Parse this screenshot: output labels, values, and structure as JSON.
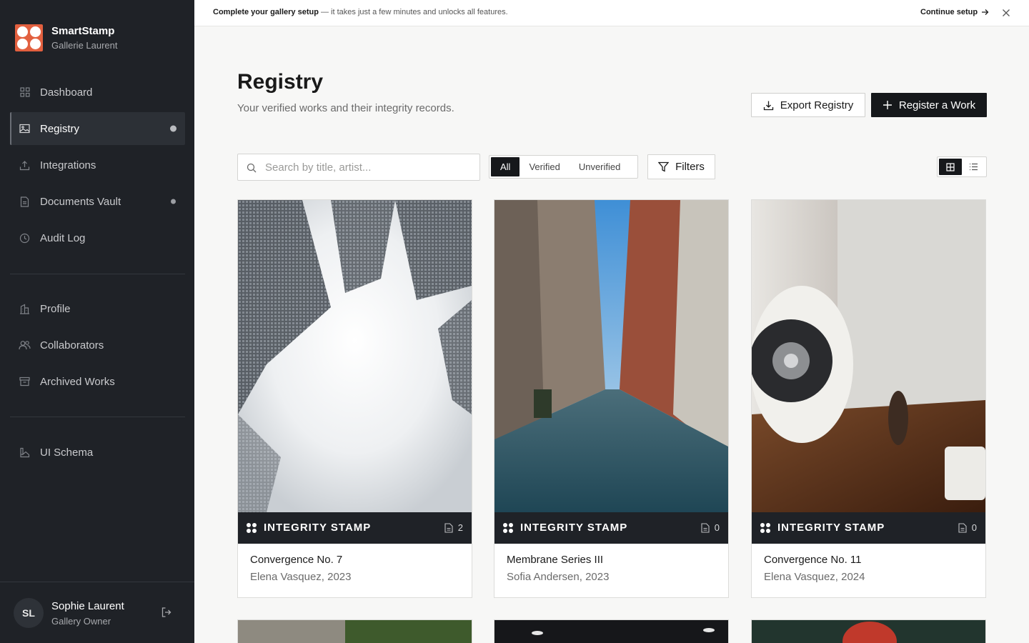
{
  "brand": {
    "name": "SmartStamp",
    "subtitle": "Gallerie Laurent",
    "accent": "#e2603f"
  },
  "sidebar": {
    "primary": [
      {
        "label": "Dashboard",
        "icon": "grid-icon"
      },
      {
        "label": "Registry",
        "icon": "image-icon",
        "active": true
      },
      {
        "label": "Integrations",
        "icon": "upload-icon"
      },
      {
        "label": "Documents Vault",
        "icon": "document-icon"
      },
      {
        "label": "Audit Log",
        "icon": "clock-icon"
      }
    ],
    "secondary": [
      {
        "label": "Profile",
        "icon": "building-icon"
      },
      {
        "label": "Collaborators",
        "icon": "users-icon"
      },
      {
        "label": "Archived Works",
        "icon": "archive-icon"
      }
    ],
    "tertiary": [
      {
        "label": "UI Schema",
        "icon": "schema-icon"
      }
    ]
  },
  "user": {
    "initials": "SL",
    "name": "Sophie Laurent",
    "role": "Gallery Owner"
  },
  "banner": {
    "bold": "Complete your gallery setup",
    "text": " — it takes just a few minutes and unlocks all features.",
    "cta": "Continue setup"
  },
  "page": {
    "title": "Registry",
    "subtitle": "Your verified works and their integrity records.",
    "export_label": "Export Registry",
    "register_label": "Register a Work"
  },
  "toolbar": {
    "search_placeholder": "Search by title, artist...",
    "filters": [
      "All",
      "Verified",
      "Unverified"
    ],
    "active_filter": "All",
    "filters_label": "Filters"
  },
  "cards": [
    {
      "title": "Convergence No. 7",
      "meta": "Elena Vasquez, 2023",
      "stamp": "INTEGRITY STAMP",
      "docs": "2"
    },
    {
      "title": "Membrane Series III",
      "meta": "Sofia Andersen, 2023",
      "stamp": "INTEGRITY STAMP",
      "docs": "0"
    },
    {
      "title": "Convergence No. 11",
      "meta": "Elena Vasquez, 2024",
      "stamp": "INTEGRITY STAMP",
      "docs": "0"
    }
  ]
}
